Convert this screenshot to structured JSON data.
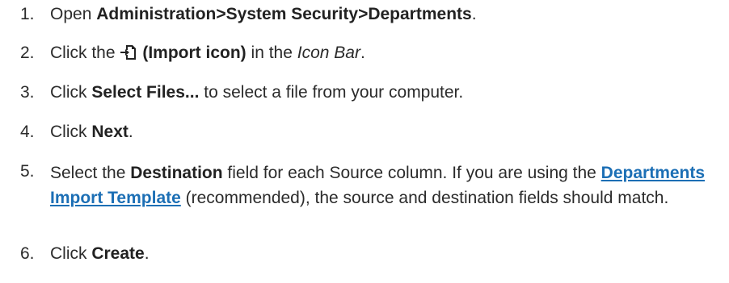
{
  "steps": [
    {
      "num": "1.",
      "pre": "Open ",
      "bold": "Administration>System Security>Departments",
      "post": "."
    },
    {
      "num": "2.",
      "pre": "Click the ",
      "icon": "import-icon",
      "bold": "(Import icon)",
      "mid": " in the ",
      "italic": "Icon Bar",
      "post": "."
    },
    {
      "num": "3.",
      "pre": "Click ",
      "bold": "Select Files...",
      "post": " to select a file from your computer."
    },
    {
      "num": "4.",
      "pre": "Click ",
      "bold": "Next",
      "post": "."
    },
    {
      "num": "5.",
      "pre": "Select the ",
      "bold": "Destination",
      "mid": " field for each Source column. If you are using the ",
      "link": "Departments Import Template",
      "post": " (recommended), the source and destination fields should match."
    },
    {
      "num": "6.",
      "pre": "Click ",
      "bold": "Create",
      "post": "."
    }
  ],
  "colors": {
    "text": "#2b2b2b",
    "link": "#1c6fb5"
  }
}
